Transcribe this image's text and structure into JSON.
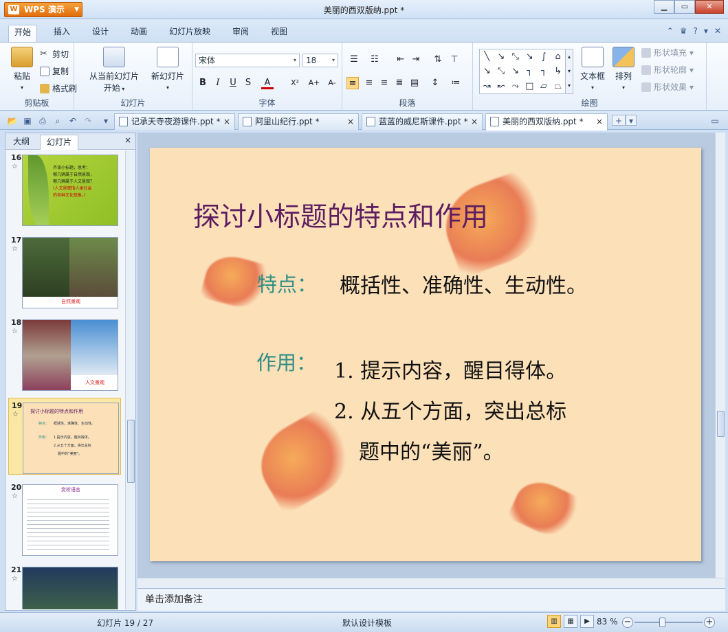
{
  "app": {
    "logo_label": "WPS 演示",
    "window_title": "美丽的西双版纳.ppt *"
  },
  "menu": {
    "tabs": [
      "开始",
      "插入",
      "设计",
      "动画",
      "幻灯片放映",
      "审阅",
      "视图"
    ],
    "active": "开始"
  },
  "ribbon": {
    "clipboard": {
      "paste": "粘贴",
      "cut": "剪切",
      "copy": "复制",
      "format_painter": "格式刷",
      "label": "剪贴板"
    },
    "slides": {
      "from_current": "从当前幻灯片",
      "from_current2": "开始",
      "new_slide": "新幻灯片",
      "label": "幻灯片"
    },
    "font": {
      "name": "宋体",
      "size": "18",
      "label": "字体",
      "bold": "B",
      "italic": "I",
      "underline": "U",
      "shadow": "S",
      "color": "A",
      "superscript": "X²",
      "grow": "A+",
      "shrink": "A-"
    },
    "paragraph": {
      "label": "段落"
    },
    "drawing": {
      "textbox": "文本框",
      "arrange": "排列",
      "fill": "形状填充",
      "outline": "形状轮廓",
      "effect": "形状效果",
      "label": "绘图"
    }
  },
  "doc_tabs": [
    {
      "name": "记承天寺夜游课件.ppt *",
      "active": false
    },
    {
      "name": "阿里山纪行.ppt *",
      "active": false
    },
    {
      "name": "蓝蓝的威尼斯课件.ppt *",
      "active": false
    },
    {
      "name": "美丽的西双版纳.ppt *",
      "active": true
    }
  ],
  "left_panel": {
    "tab_outline": "大纲",
    "tab_slides": "幻灯片",
    "close": "×",
    "thumbs": [
      {
        "num": "16",
        "line1": "齐读小标题，思考：",
        "line2": "哪几辆属于自然景观，",
        "line3": "哪几辆属于人文景观？",
        "line4": "(人文景观指人类社会",
        "line5": "的各种文化现象。)"
      },
      {
        "num": "17",
        "caption": "自然景观"
      },
      {
        "num": "18",
        "caption": "人文景观"
      },
      {
        "num": "19",
        "t": "探讨小标题的特点和作用",
        "a": "特点：",
        "a2": "概括性、准确性、生动性。",
        "b": "作用：",
        "b1": "1.提示内容，醒目得体。",
        "b2": "2.从五个方面，突出总标",
        "b3": "题中的“美丽”。"
      },
      {
        "num": "20",
        "t": "赏析语言"
      },
      {
        "num": "21"
      }
    ]
  },
  "slide": {
    "title": "探讨小标题的特点和作用",
    "feature_label": "特点：",
    "feature_text": "概括性、准确性、生动性。",
    "usage_label": "作用：",
    "point1": "1. 提示内容，醒目得体。",
    "point2": "2. 从五个方面，突出总标",
    "point3": "题中的“美丽”。"
  },
  "notes_placeholder": "单击添加备注",
  "status": {
    "slide_count": "幻灯片 19 / 27",
    "template": "默认设计模板",
    "zoom": "83 %"
  },
  "colors": {
    "title": "#5c1d61",
    "label": "#2e8e86",
    "slide_bg": "#fbe0b8",
    "accent": "#e06d0c"
  }
}
